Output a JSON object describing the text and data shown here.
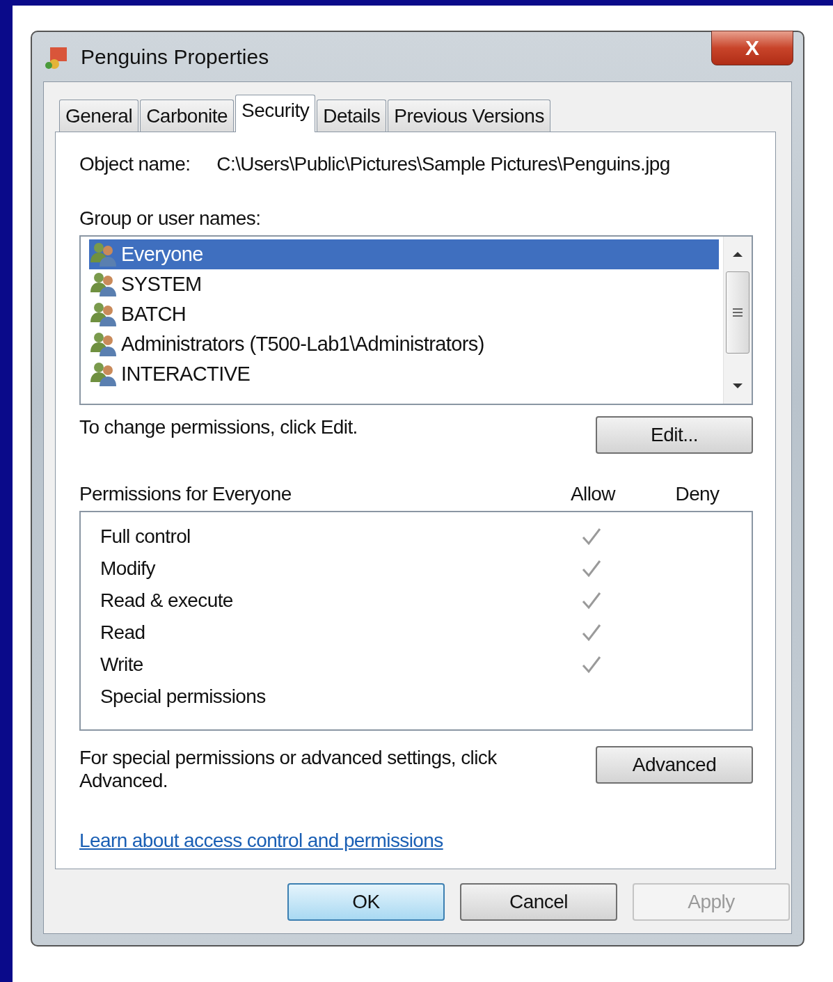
{
  "window": {
    "title": "Penguins Properties",
    "close": "X"
  },
  "tabs": [
    {
      "label": "General",
      "selected": false
    },
    {
      "label": "Carbonite",
      "selected": false
    },
    {
      "label": "Security",
      "selected": true
    },
    {
      "label": "Details",
      "selected": false
    },
    {
      "label": "Previous Versions",
      "selected": false
    }
  ],
  "object_name": {
    "label": "Object name:",
    "value": "C:\\Users\\Public\\Pictures\\Sample Pictures\\Penguins.jpg"
  },
  "groups": {
    "label": "Group or user names:",
    "items": [
      {
        "name": "Everyone",
        "selected": true
      },
      {
        "name": "SYSTEM",
        "selected": false
      },
      {
        "name": "BATCH",
        "selected": false
      },
      {
        "name": "Administrators (T500-Lab1\\Administrators)",
        "selected": false
      },
      {
        "name": "INTERACTIVE",
        "selected": false
      }
    ]
  },
  "change_hint": "To change permissions, click Edit.",
  "edit_button": "Edit...",
  "permissions": {
    "label": "Permissions for Everyone",
    "allow_heading": "Allow",
    "deny_heading": "Deny",
    "rows": [
      {
        "name": "Full control",
        "allow": true,
        "deny": false
      },
      {
        "name": "Modify",
        "allow": true,
        "deny": false
      },
      {
        "name": "Read & execute",
        "allow": true,
        "deny": false
      },
      {
        "name": "Read",
        "allow": true,
        "deny": false
      },
      {
        "name": "Write",
        "allow": true,
        "deny": false
      },
      {
        "name": "Special permissions",
        "allow": false,
        "deny": false
      }
    ]
  },
  "advanced_hint": "For special permissions or advanced settings, click Advanced.",
  "advanced_button": "Advanced",
  "link": "Learn about access control and permissions",
  "buttons": [
    {
      "label": "OK",
      "kind": "default",
      "disabled": false
    },
    {
      "label": "Cancel",
      "kind": "normal",
      "disabled": false
    },
    {
      "label": "Apply",
      "kind": "normal",
      "disabled": true
    }
  ]
}
